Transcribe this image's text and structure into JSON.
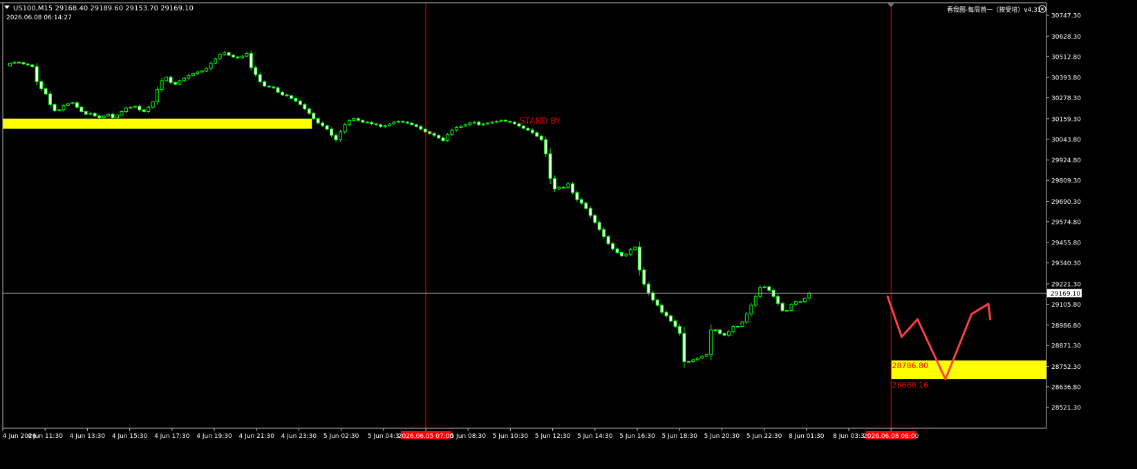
{
  "header": {
    "symbol_line": "US100,M15  29168.40 29189.60 29153.70 29169.10",
    "datetime": "2026.06.08 06:14:27",
    "indicator_label": "看我图-每周首一（按受培）v4.31"
  },
  "annotation": {
    "text": "STAND BY"
  },
  "colors": {
    "background": "#000000",
    "bull": "#ffffff",
    "bear": "#ffffff",
    "wick": "#00ff00",
    "zone": "#ffff00",
    "vline": "#ff0000",
    "price_line": "#c0c0c0",
    "axis_text": "#ffffff",
    "marker_bg": "#ff0000",
    "drawing": "#ff4040"
  },
  "chart_data": {
    "type": "candlestick",
    "title": "US100,M15",
    "ylim": [
      28521.1,
      30747.3
    ],
    "y_ticks": [
      "30747.30",
      "30628.30",
      "30512.80",
      "30393.80",
      "30278.30",
      "30159.30",
      "30043.80",
      "29924.80",
      "29809.30",
      "29690.30",
      "29574.80",
      "29455.80",
      "29340.30",
      "29221.30",
      "29105.80",
      "28986.80",
      "28871.30",
      "28752.30",
      "28636.80",
      "28521.30"
    ],
    "x_ticks": [
      "4 Jun 2026",
      "4 Jun 11:30",
      "4 Jun 13:30",
      "4 Jun 15:30",
      "4 Jun 17:30",
      "4 Jun 19:30",
      "4 Jun 21:30",
      "4 Jun 23:30",
      "5 Jun 02:30",
      "5 Jun 04:3",
      "2026.06.05 07:00",
      "5 Jun 08:30",
      "5 Jun 10:30",
      "5 Jun 12:30",
      "5 Jun 14:30",
      "5 Jun 16:30",
      "5 Jun 18:30",
      "5 Jun 20:30",
      "5 Jun 22:30",
      "8 Jun 01:30",
      "8 Jun 03:3",
      "2026.06.08 06:00"
    ],
    "highlighted_x_ticks": [
      "2026.06.05 07:00",
      "2026.06.08 06:00"
    ],
    "current_price": "29169.10",
    "ohlc_last": {
      "open": 29168.4,
      "high": 29189.6,
      "low": 29153.7,
      "close": 29169.1
    },
    "path": [
      30460,
      30475,
      30480,
      30478,
      30470,
      30465,
      30455,
      30370,
      30330,
      30300,
      30240,
      30205,
      30210,
      30235,
      30245,
      30250,
      30225,
      30200,
      30185,
      30190,
      30175,
      30165,
      30175,
      30185,
      30165,
      30180,
      30200,
      30220,
      30225,
      30230,
      30210,
      30200,
      30225,
      30255,
      30325,
      30375,
      30395,
      30365,
      30355,
      30375,
      30390,
      30405,
      30415,
      30425,
      30430,
      30445,
      30475,
      30500,
      30525,
      30535,
      30520,
      30510,
      30505,
      30515,
      30530,
      30450,
      30410,
      30370,
      30345,
      30340,
      30335,
      30310,
      30295,
      30290,
      30275,
      30260,
      30240,
      30215,
      30190,
      30160,
      30135,
      30120,
      30100,
      30065,
      30040,
      30085,
      30125,
      30150,
      30160,
      30150,
      30140,
      30138,
      30130,
      30125,
      30115,
      30120,
      30130,
      30140,
      30145,
      30140,
      30135,
      30125,
      30115,
      30100,
      30085,
      30075,
      30065,
      30050,
      30035,
      30070,
      30095,
      30110,
      30118,
      30125,
      30135,
      30140,
      30125,
      30130,
      30135,
      30140,
      30145,
      30150,
      30145,
      30140,
      30130,
      30118,
      30105,
      30095,
      30080,
      30060,
      30040,
      29960,
      29820,
      29760,
      29770,
      29770,
      29790,
      29740,
      29700,
      29680,
      29650,
      29610,
      29570,
      29530,
      29490,
      29450,
      29420,
      29400,
      29380,
      29390,
      29415,
      29430,
      29300,
      29220,
      29170,
      29130,
      29100,
      29060,
      29040,
      29010,
      28980,
      28940,
      28780,
      28780,
      28790,
      28800,
      28810,
      28820,
      28960,
      28960,
      28940,
      28930,
      28950,
      28980,
      28980,
      29005,
      29050,
      29100,
      29150,
      29200,
      29205,
      29185,
      29150,
      29110,
      29070,
      29070,
      29105,
      29120,
      29120,
      29140,
      29169.1
    ],
    "zones": [
      {
        "from_index": 0,
        "to_index": 68,
        "y_low": 30102,
        "y_high": 30160
      },
      {
        "from_index": 199,
        "to_index": 999,
        "y_low": 28680.16,
        "y_high": 28786.8,
        "labels": [
          "28786.80",
          "28680.16"
        ]
      }
    ],
    "vertical_lines_at": [
      "2026.06.05 07:00",
      "2026.06.08 06:00"
    ],
    "forecast_path": [
      [
        29150,
        0
      ],
      [
        28920,
        15
      ],
      [
        29020,
        32
      ],
      [
        28680,
        62
      ],
      [
        29050,
        90
      ],
      [
        29108,
        108
      ],
      [
        29020,
        110
      ]
    ]
  }
}
